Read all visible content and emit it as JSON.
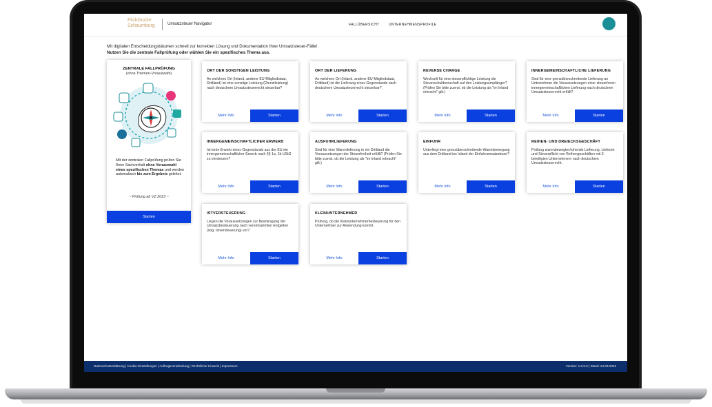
{
  "header": {
    "logo_line1": "FlickGocke",
    "logo_line2": "Schaumburg",
    "app_name": "Umsatzsteuer Navigator",
    "nav": [
      "FALLÜBERSICHT",
      "UNTERNEHMENSPROFILE"
    ]
  },
  "intro": {
    "line1": "Mit digitalen Entscheidungsbäumen schnell zur korrekten Lösung und Dokumentation Ihrer Umsatzsteuer-Fälle!",
    "line2": "Nutzen Sie die zentrale Fallprüfung oder wählen Sie ein spezifisches Thema aus."
  },
  "zentral": {
    "title": "ZENTRALE FALLPRÜFUNG",
    "subtitle": "(ohne Themen-Vorauswahl)",
    "text_a": "Mit der zentralen Fallprüfung prüfen Sie Ihren Sachverhalt ",
    "text_b": "ohne Vorauswahl eines spezifischen Themas",
    "text_c": " und werden automatisch ",
    "text_d": "bis zum Ergebnis",
    "text_e": " geleitet.",
    "note": "~ Prüfung ab VZ 2023 ~",
    "start_label": "Starten"
  },
  "labels": {
    "more": "Mehr Info",
    "start": "Starten"
  },
  "cards": [
    {
      "title": "ORT DER SONSTIGEN LEISTUNG",
      "desc": "An welchem Ort (Inland, anderer EU-Mitgliedstaat, Drittland) ist eine sonstige Leistung (Dienstleistung) nach deutschem Umsatzsteuerrecht steuerbar?"
    },
    {
      "title": "ORT DER LIEFERUNG",
      "desc": "An welchem Ort (Inland, anderer EU-Mitgliedstaat, Drittland) ist die Lieferung eines Gegenstands nach deutschem Umsatzsteuerrecht steuerbar?"
    },
    {
      "title": "REVERSE CHARGE",
      "desc": "Wechselt für eine steuerpflichtige Leistung die Steuerschuldnerschaft auf den Leistungsempfänger? (Prüfen Sie bitte zuerst, ob die Leistung als \"im Inland erbracht\" gilt.)"
    },
    {
      "title": "INNERGEMEINSCHAFTLICHE LIEFERUNG",
      "desc": "Sind für eine grenzüberschreitende Lieferung an Unternehmer die Voraussetzungen einer steuerfreien innergemeinschaftlichen Lieferung nach deutschem Umsatzsteuerrecht erfüllt?"
    },
    {
      "title": "INNERGEMEINSCHAFTLICHER ERWERB",
      "desc": "Ist beim Erwerb eines Gegenstands aus der EU ein innergemeinschaftlicher Erwerb nach §§ 1a, 1b UStG zu versteuern?"
    },
    {
      "title": "AUSFUHRLIEFERUNG",
      "desc": "Sind für eine Warenlieferung in ein Drittland die Voraussetzungen der Steuerfreiheit erfüllt? (Prüfen Sie bitte zuerst, ob die Leistung als \"im Inland erbracht\" gilt.)"
    },
    {
      "title": "EINFUHR",
      "desc": "Unterliegt eine grenzüberschreitende Warenbewegung aus dem Drittland ins Inland der Einfuhrumsatzsteuer?"
    },
    {
      "title": "REIHEN- UND DREIECKSGESCHÄFT",
      "desc": "Prüfung warenbewegter/ruhende Lieferung, Lieferort und Steuerpflicht von Reihengeschäften mit 3 beteiligten Unternehmern nach deutschem Umsatzsteuerrecht."
    },
    {
      "title": "ISTVERSTEUERUNG",
      "desc": "Liegen die Voraussetzungen zur Beantragung der Umsatzbesteuerung nach vereinnahmten Entgelten (sog. Istversteuerung) vor?"
    },
    {
      "title": "KLEINUNTERNEHMER",
      "desc": "Prüfung, ob die Kleinunternehmerbesteuerung für den Unternehmer zur Anwendung kommt."
    }
  ],
  "footer": {
    "links": "Datenschutzerklärung | Cookie-Einstellungen | Auftragsverarbeitung | Rechtlicher Hinweis | Impressum",
    "version": "Version: 1.0.5.9 | Stand: 24.09.2023"
  },
  "colors": {
    "accent": "#0a3fe0",
    "footer": "#0c2f6b",
    "avatar": "#1b8f97",
    "brand": "#c9a26a"
  }
}
